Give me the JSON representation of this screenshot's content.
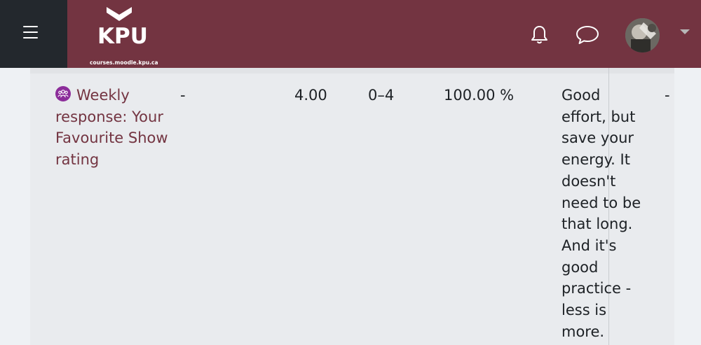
{
  "navbar": {
    "logo_text": "KPU",
    "site_url": "courses.moodle.kpu.ca",
    "icons": [
      "menu-icon",
      "bell-icon",
      "chat-icon",
      "user-avatar",
      "caret-down-icon"
    ]
  },
  "colors": {
    "navbar": "#733441",
    "menu_block": "#23282d",
    "link": "#733441",
    "activity_icon": "#8c2d9a",
    "text": "#1d2125"
  },
  "grade_row": {
    "item_name": "Weekly response: Your Favourite Show rating",
    "weight": "-",
    "grade": "4.00",
    "range": "0–4",
    "percentage": "100.00 %",
    "feedback": "Good effort, but save your energy. It doesn't need to be that long. And it's good practice - less is more.",
    "contribution": "-"
  }
}
